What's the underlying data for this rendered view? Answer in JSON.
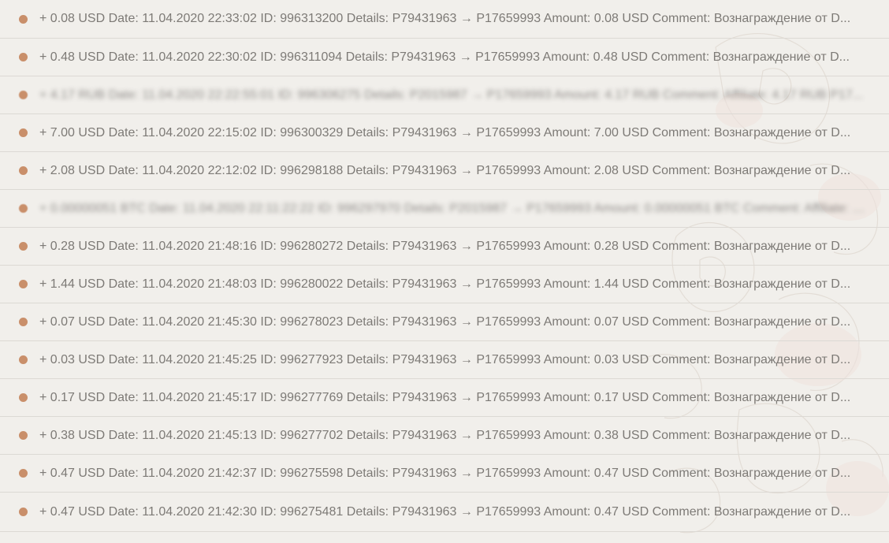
{
  "colors": {
    "background": "#f1efeb",
    "dot": "#c98f6a",
    "text": "#7d7a76",
    "divider": "#dcd9d4"
  },
  "transactions": [
    {
      "text": "+ 0.08 USD Date: 11.04.2020 22:33:02 ID: 996313200 Details: P79431963 → P17659993 Amount: 0.08 USD Comment: Вознаграждение от D...",
      "blurred": false
    },
    {
      "text": "+ 0.48 USD Date: 11.04.2020 22:30:02 ID: 996311094 Details: P79431963 → P17659993 Amount: 0.48 USD Comment: Вознаграждение от D...",
      "blurred": false
    },
    {
      "text": "+ 4.17 RUB Date: 11.04.2020 22:22:55:01 ID: 996306275 Details: P2015987 → P17659993 Amount: 4.17 RUB Comment: Affiliate: 4.17 RUB P17...",
      "blurred": true
    },
    {
      "text": "+ 7.00 USD Date: 11.04.2020 22:15:02 ID: 996300329 Details: P79431963 → P17659993 Amount: 7.00 USD Comment: Вознаграждение от D...",
      "blurred": false
    },
    {
      "text": "+ 2.08 USD Date: 11.04.2020 22:12:02 ID: 996298188 Details: P79431963 → P17659993 Amount: 2.08 USD Comment: Вознаграждение от D...",
      "blurred": false
    },
    {
      "text": "+ 0.00000051 BTC Date: 11.04.2020 22:11:22:22 ID: 996297970 Details: P2015987 → P17659993 Amount: 0.00000051 BTC Comment: Affiliate: 0...",
      "blurred": true
    },
    {
      "text": "+ 0.28 USD Date: 11.04.2020 21:48:16 ID: 996280272 Details: P79431963 → P17659993 Amount: 0.28 USD Comment: Вознаграждение от D...",
      "blurred": false
    },
    {
      "text": "+ 1.44 USD Date: 11.04.2020 21:48:03 ID: 996280022 Details: P79431963 → P17659993 Amount: 1.44 USD Comment: Вознаграждение от D...",
      "blurred": false
    },
    {
      "text": "+ 0.07 USD Date: 11.04.2020 21:45:30 ID: 996278023 Details: P79431963 → P17659993 Amount: 0.07 USD Comment: Вознаграждение от D...",
      "blurred": false
    },
    {
      "text": "+ 0.03 USD Date: 11.04.2020 21:45:25 ID: 996277923 Details: P79431963 → P17659993 Amount: 0.03 USD Comment: Вознаграждение от D...",
      "blurred": false
    },
    {
      "text": "+ 0.17 USD Date: 11.04.2020 21:45:17 ID: 996277769 Details: P79431963 → P17659993 Amount: 0.17 USD Comment: Вознаграждение от D...",
      "blurred": false
    },
    {
      "text": "+ 0.38 USD Date: 11.04.2020 21:45:13 ID: 996277702 Details: P79431963 → P17659993 Amount: 0.38 USD Comment: Вознаграждение от D...",
      "blurred": false
    },
    {
      "text": "+ 0.47 USD Date: 11.04.2020 21:42:37 ID: 996275598 Details: P79431963 → P17659993 Amount: 0.47 USD Comment: Вознаграждение от D...",
      "blurred": false
    },
    {
      "text": "+ 0.47 USD Date: 11.04.2020 21:42:30 ID: 996275481 Details: P79431963 → P17659993 Amount: 0.47 USD Comment: Вознаграждение от D...",
      "blurred": false
    }
  ]
}
